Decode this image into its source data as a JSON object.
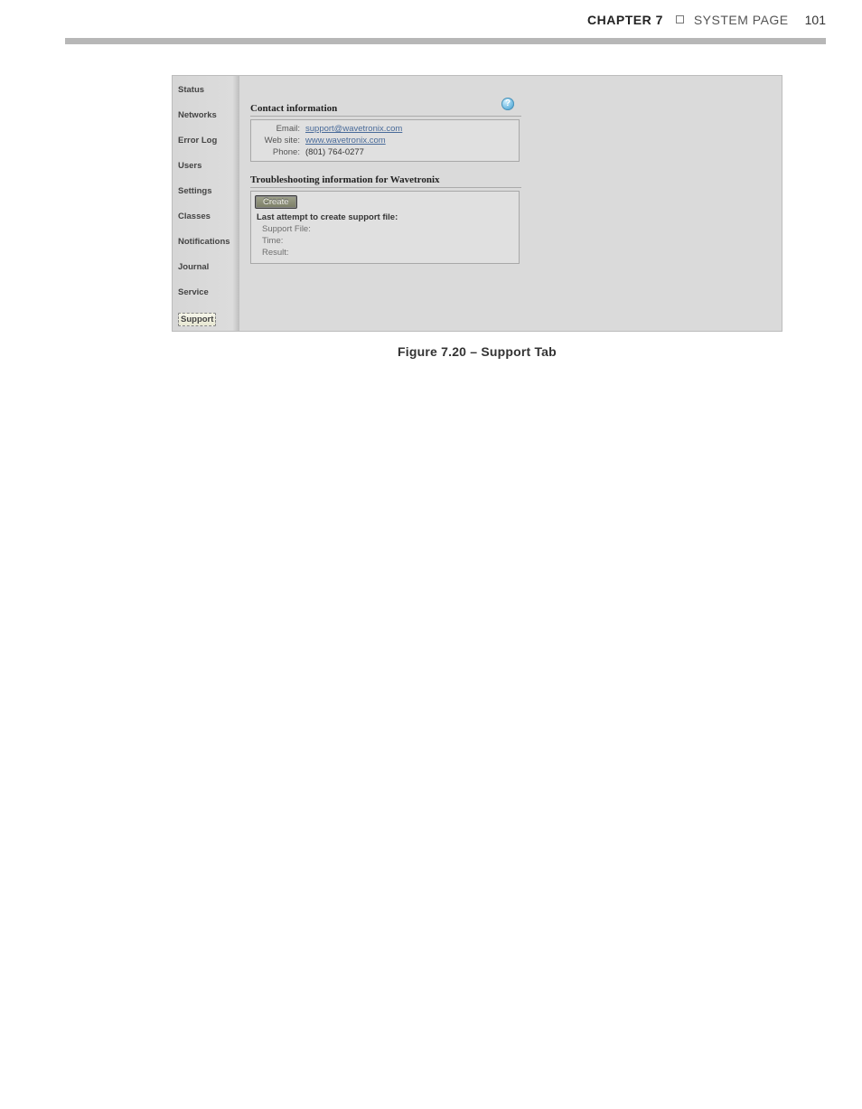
{
  "header": {
    "chapter": "CHAPTER 7",
    "title": "SYSTEM PAGE",
    "page_number": "101"
  },
  "sidebar": {
    "items": [
      "Status",
      "Networks",
      "Error Log",
      "Users",
      "Settings",
      "Classes",
      "Notifications",
      "Journal",
      "Service",
      "Support"
    ],
    "active_index": 9
  },
  "panel": {
    "help_glyph": "?",
    "contact": {
      "heading": "Contact information",
      "rows": [
        {
          "label": "Email:",
          "value": "support@wavetronix.com",
          "is_link": true
        },
        {
          "label": "Web site:",
          "value": "www.wavetronix.com",
          "is_link": true
        },
        {
          "label": "Phone:",
          "value": "(801) 764-0277",
          "is_link": false
        }
      ]
    },
    "trouble": {
      "heading": "Troubleshooting information for Wavetronix",
      "create_label": "Create",
      "last_attempt_label": "Last attempt to create support file:",
      "rows": [
        {
          "label": "Support File:",
          "value": ""
        },
        {
          "label": "Time:",
          "value": ""
        },
        {
          "label": "Result:",
          "value": ""
        }
      ]
    }
  },
  "figure_caption": "Figure 7.20 – Support Tab"
}
